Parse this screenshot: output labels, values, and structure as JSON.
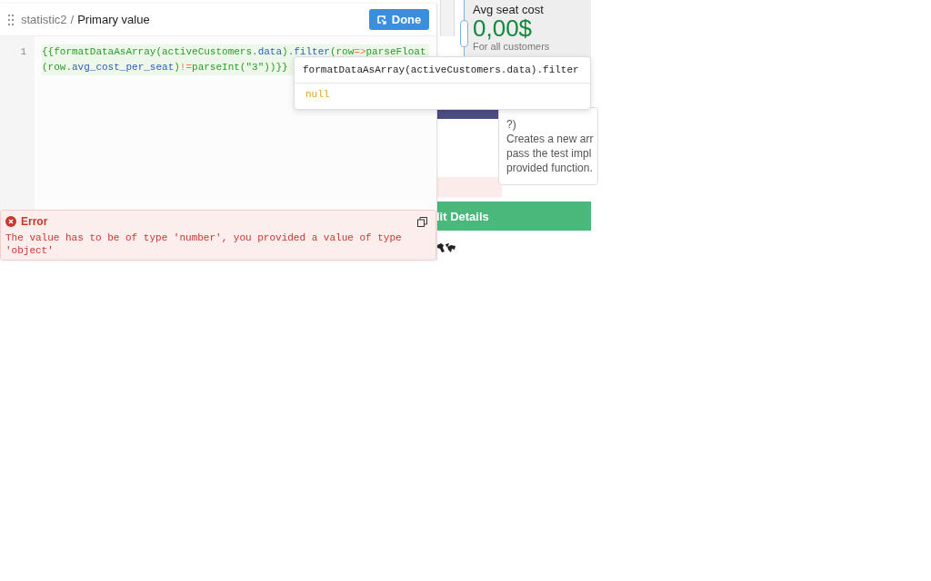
{
  "canvas": {
    "stat_card": {
      "title": "Avg seat cost",
      "value": "0,00$",
      "caption": "For all customers"
    },
    "doc_tooltip": {
      "lines": [
        "?)",
        "Creates a new arr",
        "pass the test impl",
        "provided function."
      ]
    },
    "action_button": {
      "label": "lit Details"
    }
  },
  "editor": {
    "breadcrumb": {
      "parent": "statistic2",
      "separator": "/",
      "current": "Primary value"
    },
    "done_button": {
      "label": "Done"
    },
    "line_numbers": [
      "1"
    ],
    "code": [
      {
        "text": "{{formatDataAsArray(activeCustomers",
        "kind": "plain"
      },
      {
        "text": ".data",
        "kind": "prop"
      },
      {
        "text": ")",
        "kind": "plain"
      },
      {
        "text": ".filter",
        "kind": "prop"
      },
      {
        "text": "(row",
        "kind": "plain"
      },
      {
        "text": "=>",
        "kind": "op"
      },
      {
        "text": "parseFloat(row.",
        "kind": "plain"
      },
      {
        "text": "avg_cost_per_seat",
        "kind": "prop"
      },
      {
        "text": ")",
        "kind": "plain"
      },
      {
        "text": "!=",
        "kind": "op"
      },
      {
        "text": "parseInt(\"3\"))}}",
        "kind": "plain"
      }
    ],
    "error": {
      "title": "Error",
      "message": "The value has to be of type 'number', you provided a value of type 'object'"
    }
  },
  "autocomplete": {
    "expression": "formatDataAsArray(activeCustomers.data).filter",
    "result": "null"
  }
}
